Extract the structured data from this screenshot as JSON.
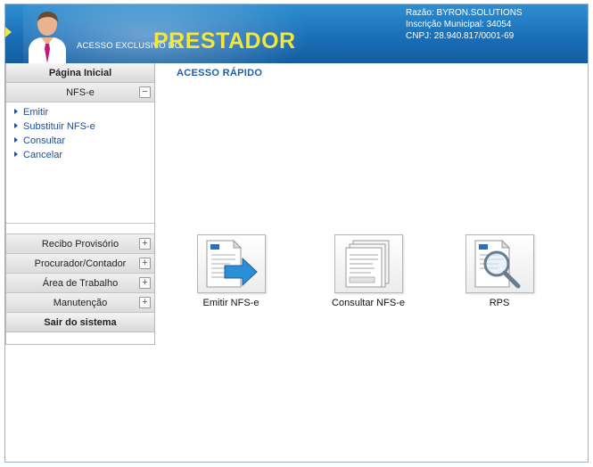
{
  "header": {
    "brand_small": "ACESSO EXCLUSIVO DO",
    "brand_big": "PRESTADOR",
    "razao": "Razão: BYRON.SOLUTIONS",
    "inscricao": "Inscrição Municipal: 34054",
    "cnpj": "CNPJ: 28.940.817/0001-69"
  },
  "sidebar": {
    "home": "Página Inicial",
    "nfse": {
      "label": "NFS-e",
      "toggle": "−"
    },
    "nfse_items": [
      "Emitir",
      "Substituir NFS-e",
      "Consultar",
      "Cancelar"
    ],
    "rows": [
      {
        "label": "Recibo Provisório",
        "toggle": "+"
      },
      {
        "label": "Procurador/Contador",
        "toggle": "+"
      },
      {
        "label": "Área de Trabalho",
        "toggle": "+"
      },
      {
        "label": "Manutenção",
        "toggle": "+"
      }
    ],
    "exit": "Sair do sistema"
  },
  "main": {
    "section_title": "ACESSO RÁPIDO",
    "tiles": [
      {
        "label": "Emitir NFS-e",
        "icon": "emit-document-arrow-icon"
      },
      {
        "label": "Consultar NFS-e",
        "icon": "document-stack-icon"
      },
      {
        "label": "RPS",
        "icon": "document-magnifier-icon"
      }
    ]
  }
}
